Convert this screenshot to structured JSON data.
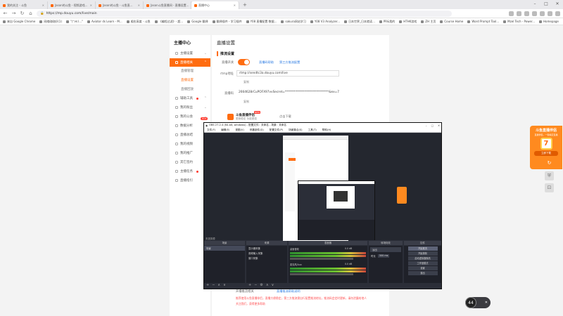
{
  "browser": {
    "tabs": [
      {
        "title": "我的关注 - 斗鱼",
        "active": false
      },
      {
        "title": "Jason的斗鱼 - 视频游戏...",
        "active": false
      },
      {
        "title": "Jason的斗鱼 - 斗鱼直...",
        "active": false
      },
      {
        "title": "Jason斗鱼直播间 - 直播设置...",
        "active": false
      },
      {
        "title": "直播中心",
        "active": true
      }
    ],
    "url": "https://mp.douyu.com/live/main",
    "bookmarks": [
      "来自 Google Chrome",
      "网络刚刚好(1)",
      "\"广州 I...\"",
      "Aviator ds Learn - M...",
      "顺应高度 - 斗鱼",
      "《编程过滤》- 超...",
      "Google 翻译",
      "翻译插件 - 学习插件",
      "Y08 直播配置 数据...",
      "sakura网站学习",
      "Y08 V3 Analyzer...",
      "日本世界_日本就读...",
      "PR&我的",
      "HTHK游戏",
      "ZH 主页",
      "Course Home",
      "Word Prompt Tool...",
      "Mzel Tech - Power...",
      "Homepage"
    ],
    "bookmarks_right": [
      "其他书签",
      "阅读清单"
    ]
  },
  "sidebar": {
    "title": "主播中心",
    "items": [
      {
        "label": "主播设置",
        "active": false,
        "chevron": "⌄"
      },
      {
        "label": "直播相关",
        "active": true,
        "chevron": "⌃"
      },
      {
        "label": "辅助工具",
        "active": false,
        "chevron": "⌃"
      },
      {
        "label": "我的粉丝",
        "active": false,
        "chevron": "⌄"
      },
      {
        "label": "我的公会",
        "active": false,
        "chevron": "⌄"
      },
      {
        "label": "数据分析",
        "active": false,
        "chevron": ""
      },
      {
        "label": "直播总结",
        "active": false,
        "chevron": ""
      },
      {
        "label": "我的视频",
        "active": false,
        "chevron": ""
      },
      {
        "label": "我的推广",
        "active": false,
        "chevron": ""
      },
      {
        "label": "其它签约",
        "active": false,
        "chevron": ""
      },
      {
        "label": "主播任务",
        "active": false,
        "chevron": ""
      },
      {
        "label": "直播指引",
        "active": false,
        "chevron": ""
      }
    ],
    "subitems": [
      {
        "label": "直播管理",
        "active": false
      },
      {
        "label": "直播设置",
        "active": true
      },
      {
        "label": "直播回放",
        "active": false
      }
    ],
    "hot_badge": "HOT"
  },
  "main": {
    "page_title": "直播设置",
    "section_title": "推流设置",
    "toggle_label": "直播开关",
    "toggle_on": true,
    "link_live_code": "直播码帮助",
    "link_third": "第三方推流配置",
    "rtmp_label": "rtmp地址",
    "rtmp_value": "rtmp://sendtc3a.douyu.com/live",
    "copy_label": "复制",
    "key_label": "直播码",
    "key_value": "2664628rCuPOFX97vvSecret=*****************************&ex=7i",
    "assistant_name": "斗鱼直播伴侣",
    "assistant_sub": "更新稳定 功能更强",
    "assistant_new": "NEW",
    "download_label": "点击下载",
    "footnote_text": "开播推流相关",
    "footnote_link": "直播推流帮助说明",
    "warn_line1": "推荐使用斗鱼直播伴侣，直播方便稳定，第三方推流需自行配置推流地址，推流码会定时更新，请勿泄露给他人",
    "warn_line2": "关注我们，获得更多帮助"
  },
  "ad": {
    "title": "斗鱼直播伴侣",
    "subtitle": "直播伴侣，一键搞定直播",
    "button": "立即下载"
  },
  "float_buttons": [
    "↻",
    "⛨",
    "⊡"
  ],
  "viewer_badge": {
    "count": "44",
    "close": "✕"
  },
  "obs": {
    "title": "OBS 27.2.4 (64-bit, windows) - 配置文件：未命名 - 场景：未命名",
    "menu": [
      "文件(F)",
      "编辑(E)",
      "视图(V)",
      "停靠部件(D)",
      "配置文件(P)",
      "场景集合(S)",
      "工具(T)",
      "帮助(H)"
    ],
    "window_controls": [
      "–",
      "□",
      "✕"
    ],
    "docks": {
      "scenes": {
        "title": "场景",
        "items": [
          "场景"
        ]
      },
      "sources": {
        "title": "来源",
        "items": [
          "显示器采集",
          "音频输入采集",
          "窗口采集"
        ]
      },
      "mixer": {
        "title": "混音器",
        "channels": [
          {
            "name": "桌面音频",
            "db": "0.0 dB"
          },
          {
            "name": "麦克风/Aux",
            "db": "0.0 dB"
          }
        ]
      },
      "transitions": {
        "title": "转场特效",
        "type": "淡出",
        "duration_label": "时长",
        "duration": "300 ms"
      },
      "controls": {
        "title": "控件",
        "buttons": [
          "开始推流",
          "开始录制",
          "启动虚拟摄像机",
          "工作室模式",
          "设置",
          "退出"
        ]
      }
    },
    "status_no_source": "未选择源"
  }
}
